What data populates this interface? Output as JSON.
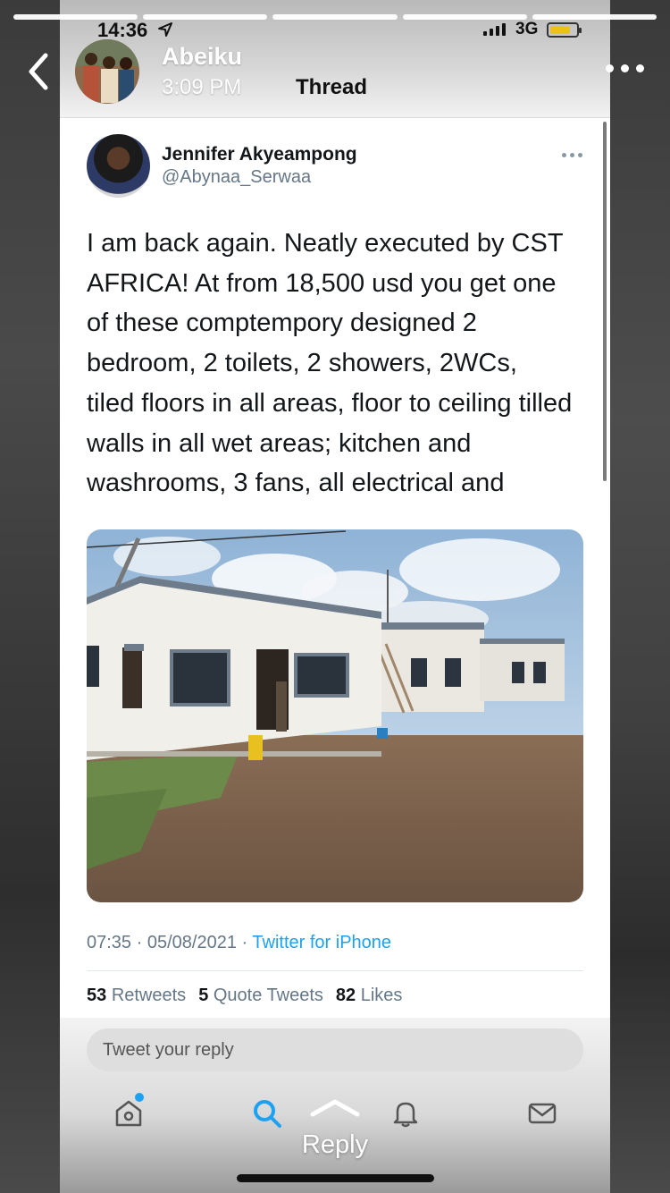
{
  "story": {
    "progress_segments": 5,
    "user_name": "Abeiku",
    "posted_time": "3:09 PM",
    "reply_label": "Reply"
  },
  "status_bar": {
    "time": "14:36",
    "network": "3G",
    "battery_color": "#e8c31a"
  },
  "thread": {
    "title": "Thread"
  },
  "tweet": {
    "author_name": "Jennifer Akyeampong",
    "author_handle": "@Abynaa_Serwaa",
    "text_lines": [
      "I am back again. Neatly executed by CST",
      "AFRICA! At from 18,500 usd you get one",
      "of these comptempory designed 2",
      "bedroom, 2 toilets, 2 showers, 2WCs,",
      "tiled floors in all areas, floor to ceiling tilled",
      "walls in all wet areas; kitchen and",
      "washrooms, 3 fans, all electrical and"
    ],
    "time": "07:35",
    "date": "05/08/2021",
    "separator": "·",
    "source": "Twitter for iPhone",
    "retweets_count": "53",
    "retweets_label": "Retweets",
    "quote_count": "5",
    "quote_label": "Quote Tweets",
    "likes_count": "82",
    "likes_label": "Likes"
  },
  "reply_box": {
    "placeholder": "Tweet your reply"
  },
  "tab_bar": {
    "items": [
      "home-icon",
      "search-icon",
      "notifications-icon",
      "messages-icon"
    ],
    "accent": "#1da1f2"
  }
}
